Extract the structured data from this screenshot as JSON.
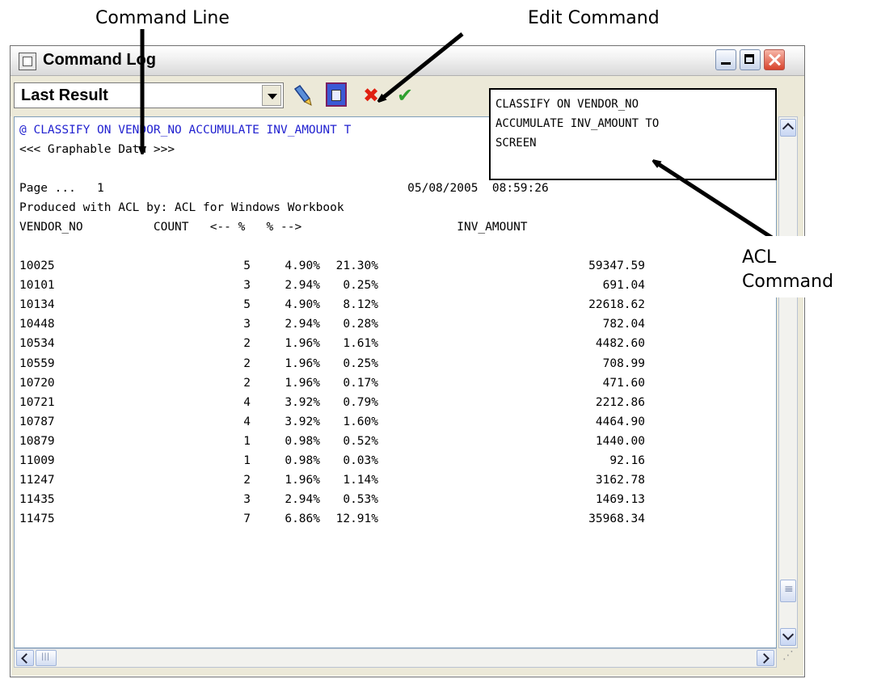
{
  "callouts": {
    "command_line": "Command Line",
    "edit_command": "Edit Command",
    "acl_line1": "ACL",
    "acl_line2": "Command"
  },
  "window": {
    "title": "Command Log"
  },
  "toolbar": {
    "result_select": {
      "selected": "Last Result"
    },
    "icons": [
      "pen-icon",
      "edit-command-icon",
      "cancel-icon",
      "accept-icon"
    ],
    "cancel_glyph": "✖",
    "accept_glyph": "✔"
  },
  "command_popup": {
    "lines": [
      "CLASSIFY ON VENDOR_NO",
      "ACCUMULATE INV_AMOUNT TO",
      "SCREEN"
    ]
  },
  "log": {
    "command_line": "@ CLASSIFY ON VENDOR_NO ACCUMULATE INV_AMOUNT T",
    "graphable": "<<< Graphable Data >>>",
    "page_line": "Page ...   1                                           05/08/2005  08:59:26",
    "produced": "Produced with ACL by: ACL for Windows Workbook",
    "header": "VENDOR_NO          COUNT   <-- %   % -->                      INV_AMOUNT",
    "rows": [
      {
        "vendor": "10025",
        "count": "5",
        "pct_count": "4.90%",
        "pct_amount": "21.30%",
        "amount": "59347.59"
      },
      {
        "vendor": "10101",
        "count": "3",
        "pct_count": "2.94%",
        "pct_amount": "0.25%",
        "amount": "691.04"
      },
      {
        "vendor": "10134",
        "count": "5",
        "pct_count": "4.90%",
        "pct_amount": "8.12%",
        "amount": "22618.62"
      },
      {
        "vendor": "10448",
        "count": "3",
        "pct_count": "2.94%",
        "pct_amount": "0.28%",
        "amount": "782.04"
      },
      {
        "vendor": "10534",
        "count": "2",
        "pct_count": "1.96%",
        "pct_amount": "1.61%",
        "amount": "4482.60"
      },
      {
        "vendor": "10559",
        "count": "2",
        "pct_count": "1.96%",
        "pct_amount": "0.25%",
        "amount": "708.99"
      },
      {
        "vendor": "10720",
        "count": "2",
        "pct_count": "1.96%",
        "pct_amount": "0.17%",
        "amount": "471.60"
      },
      {
        "vendor": "10721",
        "count": "4",
        "pct_count": "3.92%",
        "pct_amount": "0.79%",
        "amount": "2212.86"
      },
      {
        "vendor": "10787",
        "count": "4",
        "pct_count": "3.92%",
        "pct_amount": "1.60%",
        "amount": "4464.90"
      },
      {
        "vendor": "10879",
        "count": "1",
        "pct_count": "0.98%",
        "pct_amount": "0.52%",
        "amount": "1440.00"
      },
      {
        "vendor": "11009",
        "count": "1",
        "pct_count": "0.98%",
        "pct_amount": "0.03%",
        "amount": "92.16"
      },
      {
        "vendor": "11247",
        "count": "2",
        "pct_count": "1.96%",
        "pct_amount": "1.14%",
        "amount": "3162.78"
      },
      {
        "vendor": "11435",
        "count": "3",
        "pct_count": "2.94%",
        "pct_amount": "0.53%",
        "amount": "1469.13"
      },
      {
        "vendor": "11475",
        "count": "7",
        "pct_count": "6.86%",
        "pct_amount": "12.91%",
        "amount": "35968.34"
      }
    ]
  }
}
